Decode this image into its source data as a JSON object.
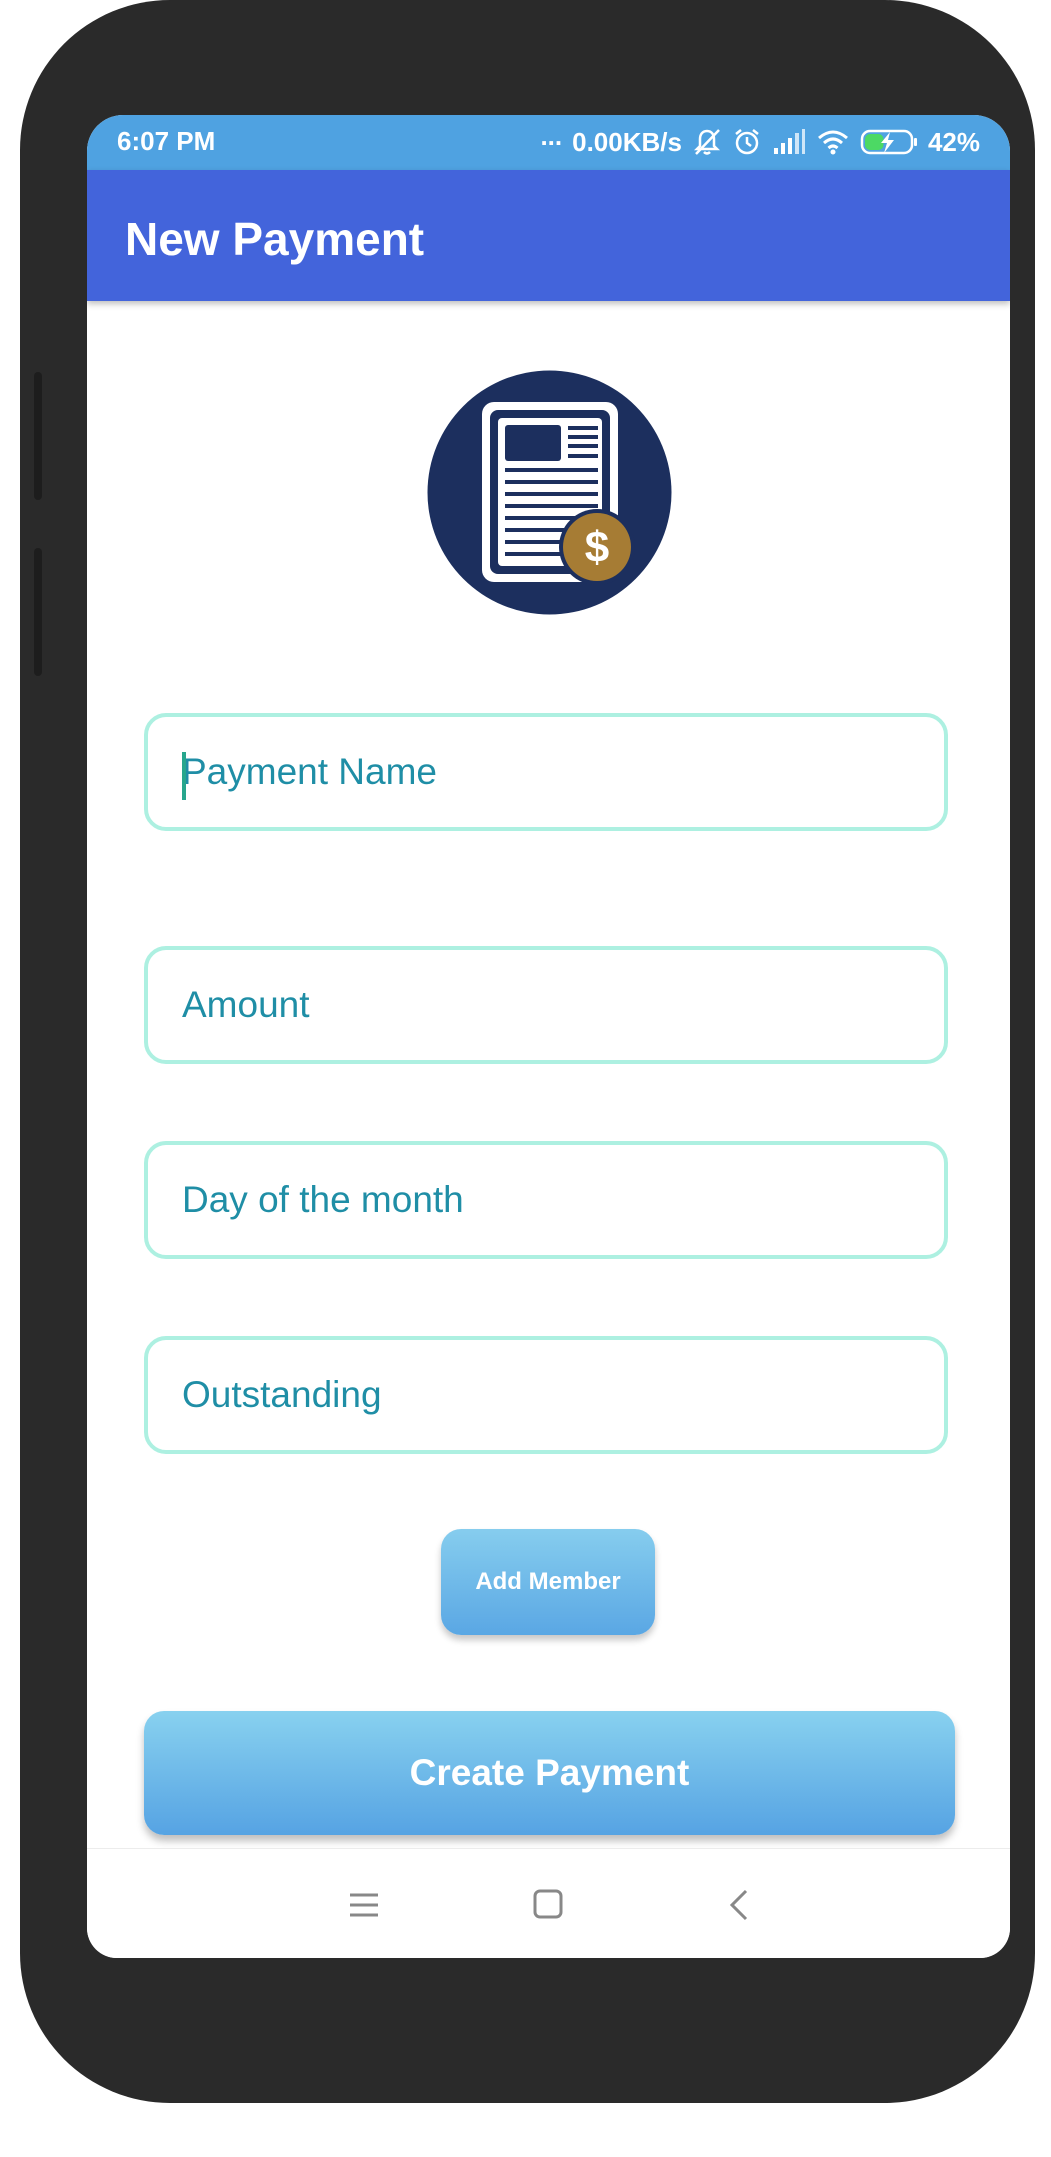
{
  "status_bar": {
    "time": "6:07 PM",
    "more": "...",
    "network_speed": "0.00KB/s",
    "battery_percent": "42%",
    "battery_level": 0.42,
    "icons": [
      "mute-icon",
      "alarm-icon",
      "signal-icon",
      "wifi-icon",
      "battery-charging-icon"
    ]
  },
  "app_bar": {
    "title": "New Payment"
  },
  "logo": {
    "icon": "payment-document-icon",
    "badge": "$",
    "colors": {
      "circle": "#1c2f5e",
      "coin": "#a67c34"
    }
  },
  "form": {
    "payment_name": {
      "placeholder": "Payment Name"
    },
    "amount": {
      "placeholder": "Amount"
    },
    "day_of_month": {
      "placeholder": "Day of the month"
    },
    "outstanding": {
      "placeholder": "Outstanding"
    }
  },
  "buttons": {
    "add_member": "Add Member",
    "create_payment": "Create Payment"
  },
  "nav_bar": {
    "icons": [
      "menu-icon",
      "home-icon",
      "back-icon"
    ]
  },
  "colors": {
    "status_bar": "#4fa2e1",
    "app_bar": "#4364db",
    "field_border": "#adf0e1",
    "field_text": "#1f8ea6"
  }
}
